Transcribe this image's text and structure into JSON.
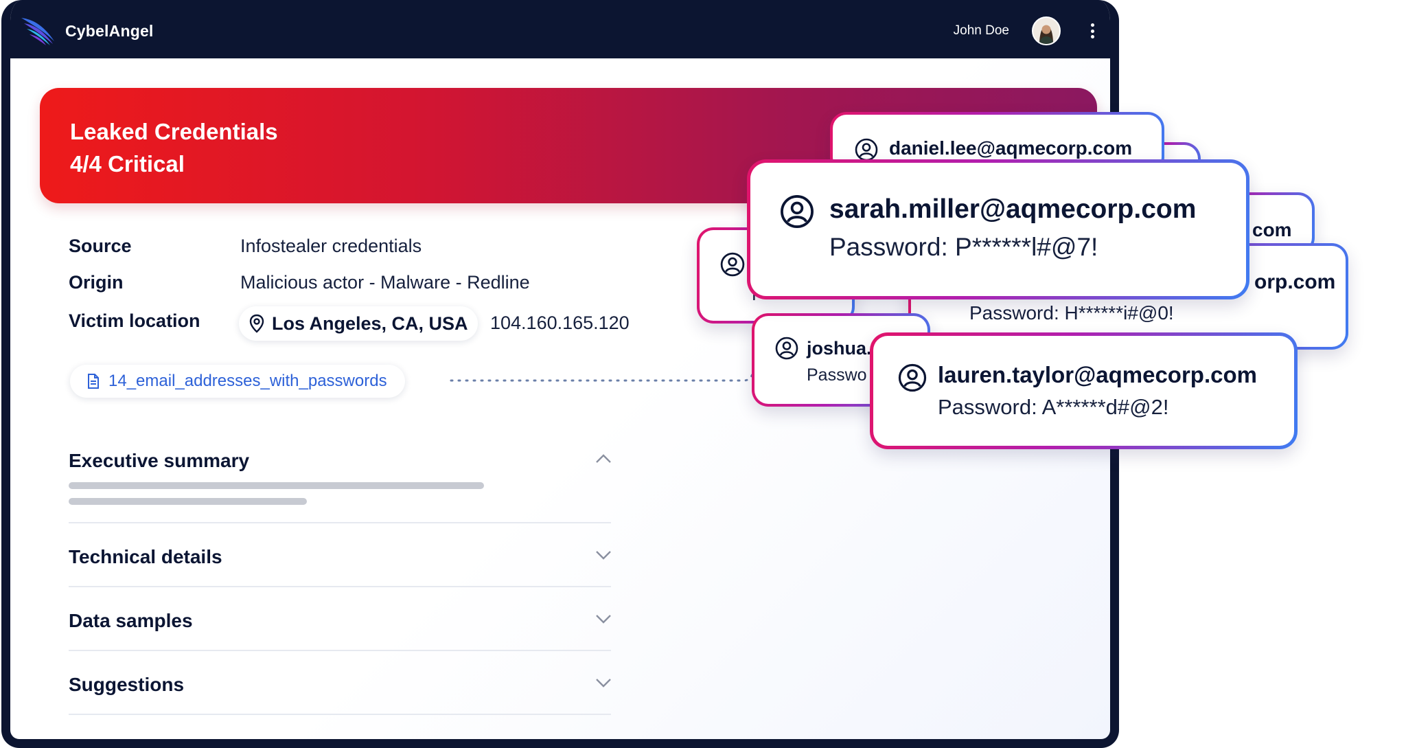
{
  "app": {
    "name": "CybelAngel",
    "user_name": "John Doe"
  },
  "alert": {
    "title": "Leaked Credentials",
    "severity": "4/4 Critical"
  },
  "details": {
    "source_label": "Source",
    "source_value": "Infostealer credentials",
    "origin_label": "Origin",
    "origin_value": "Malicious actor - Malware - Redline",
    "location_label": "Victim location",
    "location_value": "Los Angeles, CA, USA",
    "ip_value": "104.160.165.120"
  },
  "attachment": {
    "filename": "14_email_addresses_with_passwords"
  },
  "sections": [
    {
      "title": "Executive summary",
      "expanded": true
    },
    {
      "title": "Technical details",
      "expanded": false
    },
    {
      "title": "Data samples",
      "expanded": false
    },
    {
      "title": "Suggestions",
      "expanded": false
    }
  ],
  "credential_cards": {
    "back_a": {
      "email": "daniel.lee@aqmecorp.com"
    },
    "back_b": {
      "email_fragment": "com"
    },
    "back_c": {
      "email_fragment": "orp.com",
      "password": "Password: H******i#@0!"
    },
    "back_d": {
      "text_fragment": "F"
    },
    "back_e": {
      "email": "joshua.c",
      "password": "Passwo"
    },
    "front": {
      "email": "sarah.miller@aqmecorp.com",
      "password": "Password: P******l#@7!"
    },
    "bottom": {
      "email": "lauren.taylor@aqmecorp.com",
      "password": "Password: A******d#@2!"
    }
  },
  "colors": {
    "navbar": "#0c1531",
    "banner_start": "#ee1a1a",
    "banner_end": "#8b1860",
    "link_blue": "#2d61d8",
    "card_border_pink": "#c21e9e",
    "card_border_blue": "#3f7cf2"
  },
  "icons": [
    "cybelangel-wing-logo",
    "user-avatar",
    "more-vertical-icon",
    "location-pin-icon",
    "file-icon",
    "user-circle-icon",
    "chevron-up-icon",
    "chevron-down-icon"
  ]
}
